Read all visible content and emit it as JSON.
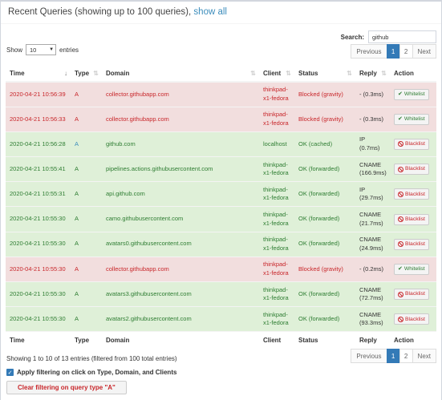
{
  "header": {
    "title": "Recent Queries (showing up to 100 queries),",
    "show_all_link": "show all"
  },
  "search": {
    "label": "Search:",
    "value": "github"
  },
  "length": {
    "label_before": "Show",
    "selected": "10",
    "label_after": "entries"
  },
  "pagination": {
    "prev": "Previous",
    "pages": [
      "1",
      "2"
    ],
    "active": "1",
    "next": "Next"
  },
  "table": {
    "columns": [
      "Time",
      "Type",
      "Domain",
      "Client",
      "Status",
      "Reply",
      "Action"
    ],
    "rows": [
      {
        "time": "2020-04-21 10:56:39",
        "type": "A",
        "domain": "collector.githubapp.com",
        "client": "thinkpad-x1-fedora",
        "status": "Blocked (gravity)",
        "reply": "- (0.3ms)",
        "action": "Whitelist",
        "state": "blocked"
      },
      {
        "time": "2020-04-21 10:56:33",
        "type": "A",
        "domain": "collector.githubapp.com",
        "client": "thinkpad-x1-fedora",
        "status": "Blocked (gravity)",
        "reply": "- (0.3ms)",
        "action": "Whitelist",
        "state": "blocked"
      },
      {
        "time": "2020-04-21 10:56:28",
        "type": "A",
        "domain": "github.com",
        "client": "localhost",
        "status": "OK (cached)",
        "reply": "IP (0.7ms)",
        "action": "Blacklist",
        "state": "allowed"
      },
      {
        "time": "2020-04-21 10:55:41",
        "type": "A",
        "domain": "pipelines.actions.githubusercontent.com",
        "client": "thinkpad-x1-fedora",
        "status": "OK (forwarded)",
        "reply": "CNAME (166.9ms)",
        "action": "Blacklist",
        "state": "allowed"
      },
      {
        "time": "2020-04-21 10:55:31",
        "type": "A",
        "domain": "api.github.com",
        "client": "thinkpad-x1-fedora",
        "status": "OK (forwarded)",
        "reply": "IP (29.7ms)",
        "action": "Blacklist",
        "state": "allowed"
      },
      {
        "time": "2020-04-21 10:55:30",
        "type": "A",
        "domain": "camo.githubusercontent.com",
        "client": "thinkpad-x1-fedora",
        "status": "OK (forwarded)",
        "reply": "CNAME (21.7ms)",
        "action": "Blacklist",
        "state": "allowed"
      },
      {
        "time": "2020-04-21 10:55:30",
        "type": "A",
        "domain": "avatars0.githubusercontent.com",
        "client": "thinkpad-x1-fedora",
        "status": "OK (forwarded)",
        "reply": "CNAME (24.9ms)",
        "action": "Blacklist",
        "state": "allowed"
      },
      {
        "time": "2020-04-21 10:55:30",
        "type": "A",
        "domain": "collector.githubapp.com",
        "client": "thinkpad-x1-fedora",
        "status": "Blocked (gravity)",
        "reply": "- (0.2ms)",
        "action": "Whitelist",
        "state": "blocked"
      },
      {
        "time": "2020-04-21 10:55:30",
        "type": "A",
        "domain": "avatars3.githubusercontent.com",
        "client": "thinkpad-x1-fedora",
        "status": "OK (forwarded)",
        "reply": "CNAME (72.7ms)",
        "action": "Blacklist",
        "state": "allowed"
      },
      {
        "time": "2020-04-21 10:55:30",
        "type": "A",
        "domain": "avatars2.githubusercontent.com",
        "client": "thinkpad-x1-fedora",
        "status": "OK (forwarded)",
        "reply": "CNAME (93.3ms)",
        "action": "Blacklist",
        "state": "allowed"
      }
    ]
  },
  "info_text": "Showing 1 to 10 of 13 entries (filtered from 100 total entries)",
  "filter_checkbox_label": "Apply filtering on click on Type, Domain, and Clients",
  "clear_filter_button": "Clear filtering on query type \"A\"",
  "colors": {
    "blocked_bg": "#f2dede",
    "allowed_bg": "#dff0d8",
    "blocked_text": "#c8262a",
    "allowed_text": "#2e7d32",
    "link": "#3c8dbc",
    "active_page": "#337ab7"
  }
}
